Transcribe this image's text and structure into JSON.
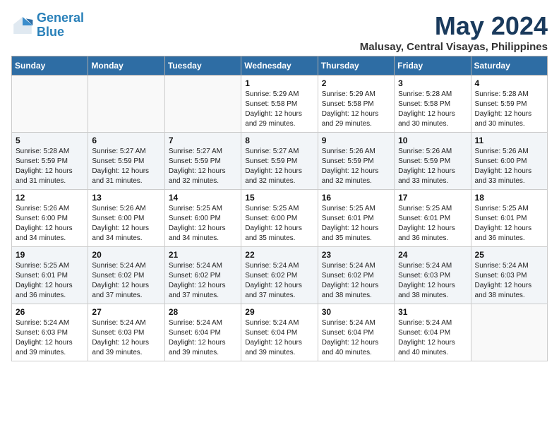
{
  "logo": {
    "line1": "General",
    "line2": "Blue"
  },
  "title": "May 2024",
  "subtitle": "Malusay, Central Visayas, Philippines",
  "weekdays": [
    "Sunday",
    "Monday",
    "Tuesday",
    "Wednesday",
    "Thursday",
    "Friday",
    "Saturday"
  ],
  "weeks": [
    [
      {
        "day": "",
        "info": ""
      },
      {
        "day": "",
        "info": ""
      },
      {
        "day": "",
        "info": ""
      },
      {
        "day": "1",
        "info": "Sunrise: 5:29 AM\nSunset: 5:58 PM\nDaylight: 12 hours\nand 29 minutes."
      },
      {
        "day": "2",
        "info": "Sunrise: 5:29 AM\nSunset: 5:58 PM\nDaylight: 12 hours\nand 29 minutes."
      },
      {
        "day": "3",
        "info": "Sunrise: 5:28 AM\nSunset: 5:58 PM\nDaylight: 12 hours\nand 30 minutes."
      },
      {
        "day": "4",
        "info": "Sunrise: 5:28 AM\nSunset: 5:59 PM\nDaylight: 12 hours\nand 30 minutes."
      }
    ],
    [
      {
        "day": "5",
        "info": "Sunrise: 5:28 AM\nSunset: 5:59 PM\nDaylight: 12 hours\nand 31 minutes."
      },
      {
        "day": "6",
        "info": "Sunrise: 5:27 AM\nSunset: 5:59 PM\nDaylight: 12 hours\nand 31 minutes."
      },
      {
        "day": "7",
        "info": "Sunrise: 5:27 AM\nSunset: 5:59 PM\nDaylight: 12 hours\nand 32 minutes."
      },
      {
        "day": "8",
        "info": "Sunrise: 5:27 AM\nSunset: 5:59 PM\nDaylight: 12 hours\nand 32 minutes."
      },
      {
        "day": "9",
        "info": "Sunrise: 5:26 AM\nSunset: 5:59 PM\nDaylight: 12 hours\nand 32 minutes."
      },
      {
        "day": "10",
        "info": "Sunrise: 5:26 AM\nSunset: 5:59 PM\nDaylight: 12 hours\nand 33 minutes."
      },
      {
        "day": "11",
        "info": "Sunrise: 5:26 AM\nSunset: 6:00 PM\nDaylight: 12 hours\nand 33 minutes."
      }
    ],
    [
      {
        "day": "12",
        "info": "Sunrise: 5:26 AM\nSunset: 6:00 PM\nDaylight: 12 hours\nand 34 minutes."
      },
      {
        "day": "13",
        "info": "Sunrise: 5:26 AM\nSunset: 6:00 PM\nDaylight: 12 hours\nand 34 minutes."
      },
      {
        "day": "14",
        "info": "Sunrise: 5:25 AM\nSunset: 6:00 PM\nDaylight: 12 hours\nand 34 minutes."
      },
      {
        "day": "15",
        "info": "Sunrise: 5:25 AM\nSunset: 6:00 PM\nDaylight: 12 hours\nand 35 minutes."
      },
      {
        "day": "16",
        "info": "Sunrise: 5:25 AM\nSunset: 6:01 PM\nDaylight: 12 hours\nand 35 minutes."
      },
      {
        "day": "17",
        "info": "Sunrise: 5:25 AM\nSunset: 6:01 PM\nDaylight: 12 hours\nand 36 minutes."
      },
      {
        "day": "18",
        "info": "Sunrise: 5:25 AM\nSunset: 6:01 PM\nDaylight: 12 hours\nand 36 minutes."
      }
    ],
    [
      {
        "day": "19",
        "info": "Sunrise: 5:25 AM\nSunset: 6:01 PM\nDaylight: 12 hours\nand 36 minutes."
      },
      {
        "day": "20",
        "info": "Sunrise: 5:24 AM\nSunset: 6:02 PM\nDaylight: 12 hours\nand 37 minutes."
      },
      {
        "day": "21",
        "info": "Sunrise: 5:24 AM\nSunset: 6:02 PM\nDaylight: 12 hours\nand 37 minutes."
      },
      {
        "day": "22",
        "info": "Sunrise: 5:24 AM\nSunset: 6:02 PM\nDaylight: 12 hours\nand 37 minutes."
      },
      {
        "day": "23",
        "info": "Sunrise: 5:24 AM\nSunset: 6:02 PM\nDaylight: 12 hours\nand 38 minutes."
      },
      {
        "day": "24",
        "info": "Sunrise: 5:24 AM\nSunset: 6:03 PM\nDaylight: 12 hours\nand 38 minutes."
      },
      {
        "day": "25",
        "info": "Sunrise: 5:24 AM\nSunset: 6:03 PM\nDaylight: 12 hours\nand 38 minutes."
      }
    ],
    [
      {
        "day": "26",
        "info": "Sunrise: 5:24 AM\nSunset: 6:03 PM\nDaylight: 12 hours\nand 39 minutes."
      },
      {
        "day": "27",
        "info": "Sunrise: 5:24 AM\nSunset: 6:03 PM\nDaylight: 12 hours\nand 39 minutes."
      },
      {
        "day": "28",
        "info": "Sunrise: 5:24 AM\nSunset: 6:04 PM\nDaylight: 12 hours\nand 39 minutes."
      },
      {
        "day": "29",
        "info": "Sunrise: 5:24 AM\nSunset: 6:04 PM\nDaylight: 12 hours\nand 39 minutes."
      },
      {
        "day": "30",
        "info": "Sunrise: 5:24 AM\nSunset: 6:04 PM\nDaylight: 12 hours\nand 40 minutes."
      },
      {
        "day": "31",
        "info": "Sunrise: 5:24 AM\nSunset: 6:04 PM\nDaylight: 12 hours\nand 40 minutes."
      },
      {
        "day": "",
        "info": ""
      }
    ]
  ]
}
